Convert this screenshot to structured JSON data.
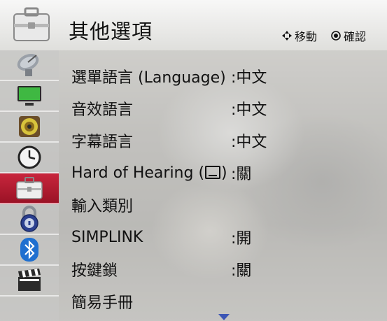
{
  "header": {
    "title": "其他選項",
    "move_hint": "移動",
    "ok_hint": "確認"
  },
  "sidebar": {
    "items": [
      {
        "icon": "satellite-dish-icon",
        "active": false
      },
      {
        "icon": "monitor-icon",
        "active": false
      },
      {
        "icon": "speaker-icon",
        "active": false
      },
      {
        "icon": "clock-icon",
        "active": false
      },
      {
        "icon": "toolbox-icon",
        "active": true
      },
      {
        "icon": "lock-icon",
        "active": false
      },
      {
        "icon": "bluetooth-icon",
        "active": false
      },
      {
        "icon": "clapperboard-icon",
        "active": false
      }
    ]
  },
  "menu": {
    "items": [
      {
        "label": "選單語言 (Language)",
        "value": ":中文"
      },
      {
        "label": "音效語言",
        "value": ":中文"
      },
      {
        "label": "字幕語言",
        "value": ":中文"
      },
      {
        "label_before": "Hard of Hearing (",
        "label_after": ")",
        "value": ":關"
      },
      {
        "label": "輸入類別",
        "value": ""
      },
      {
        "label": "SIMPLINK",
        "value": ":開"
      },
      {
        "label": "按鍵鎖",
        "value": ":關"
      },
      {
        "label": "簡易手冊",
        "value": ""
      }
    ]
  },
  "colors": {
    "active_item": "#b51c32",
    "scroll_arrow": "#3c55b5"
  }
}
